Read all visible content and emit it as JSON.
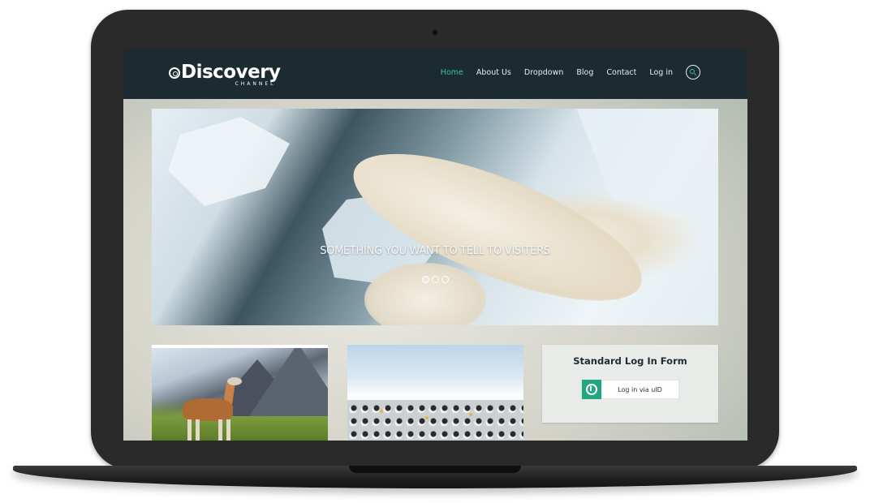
{
  "brand": {
    "logo_text": "Discovery",
    "logo_subtext": "CHANNEL"
  },
  "nav": {
    "items": [
      {
        "label": "Home",
        "active": true
      },
      {
        "label": "About Us",
        "active": false
      },
      {
        "label": "Dropdown",
        "active": false
      },
      {
        "label": "Blog",
        "active": false
      },
      {
        "label": "Contact",
        "active": false
      },
      {
        "label": "Log in",
        "active": false
      }
    ],
    "search_icon": "search-icon",
    "active_color": "#3fbf9a"
  },
  "hero": {
    "caption": "SOMETHING YOU WANT TO TELL TO VISITERS",
    "slides_count": 3,
    "active_slide": 1
  },
  "login": {
    "title": "Standard Log In Form",
    "button_label": "Log in via uID",
    "button_icon": "uid-icon",
    "accent": "#22a783"
  },
  "theme": {
    "navbar_bg": "#1c2b31"
  }
}
